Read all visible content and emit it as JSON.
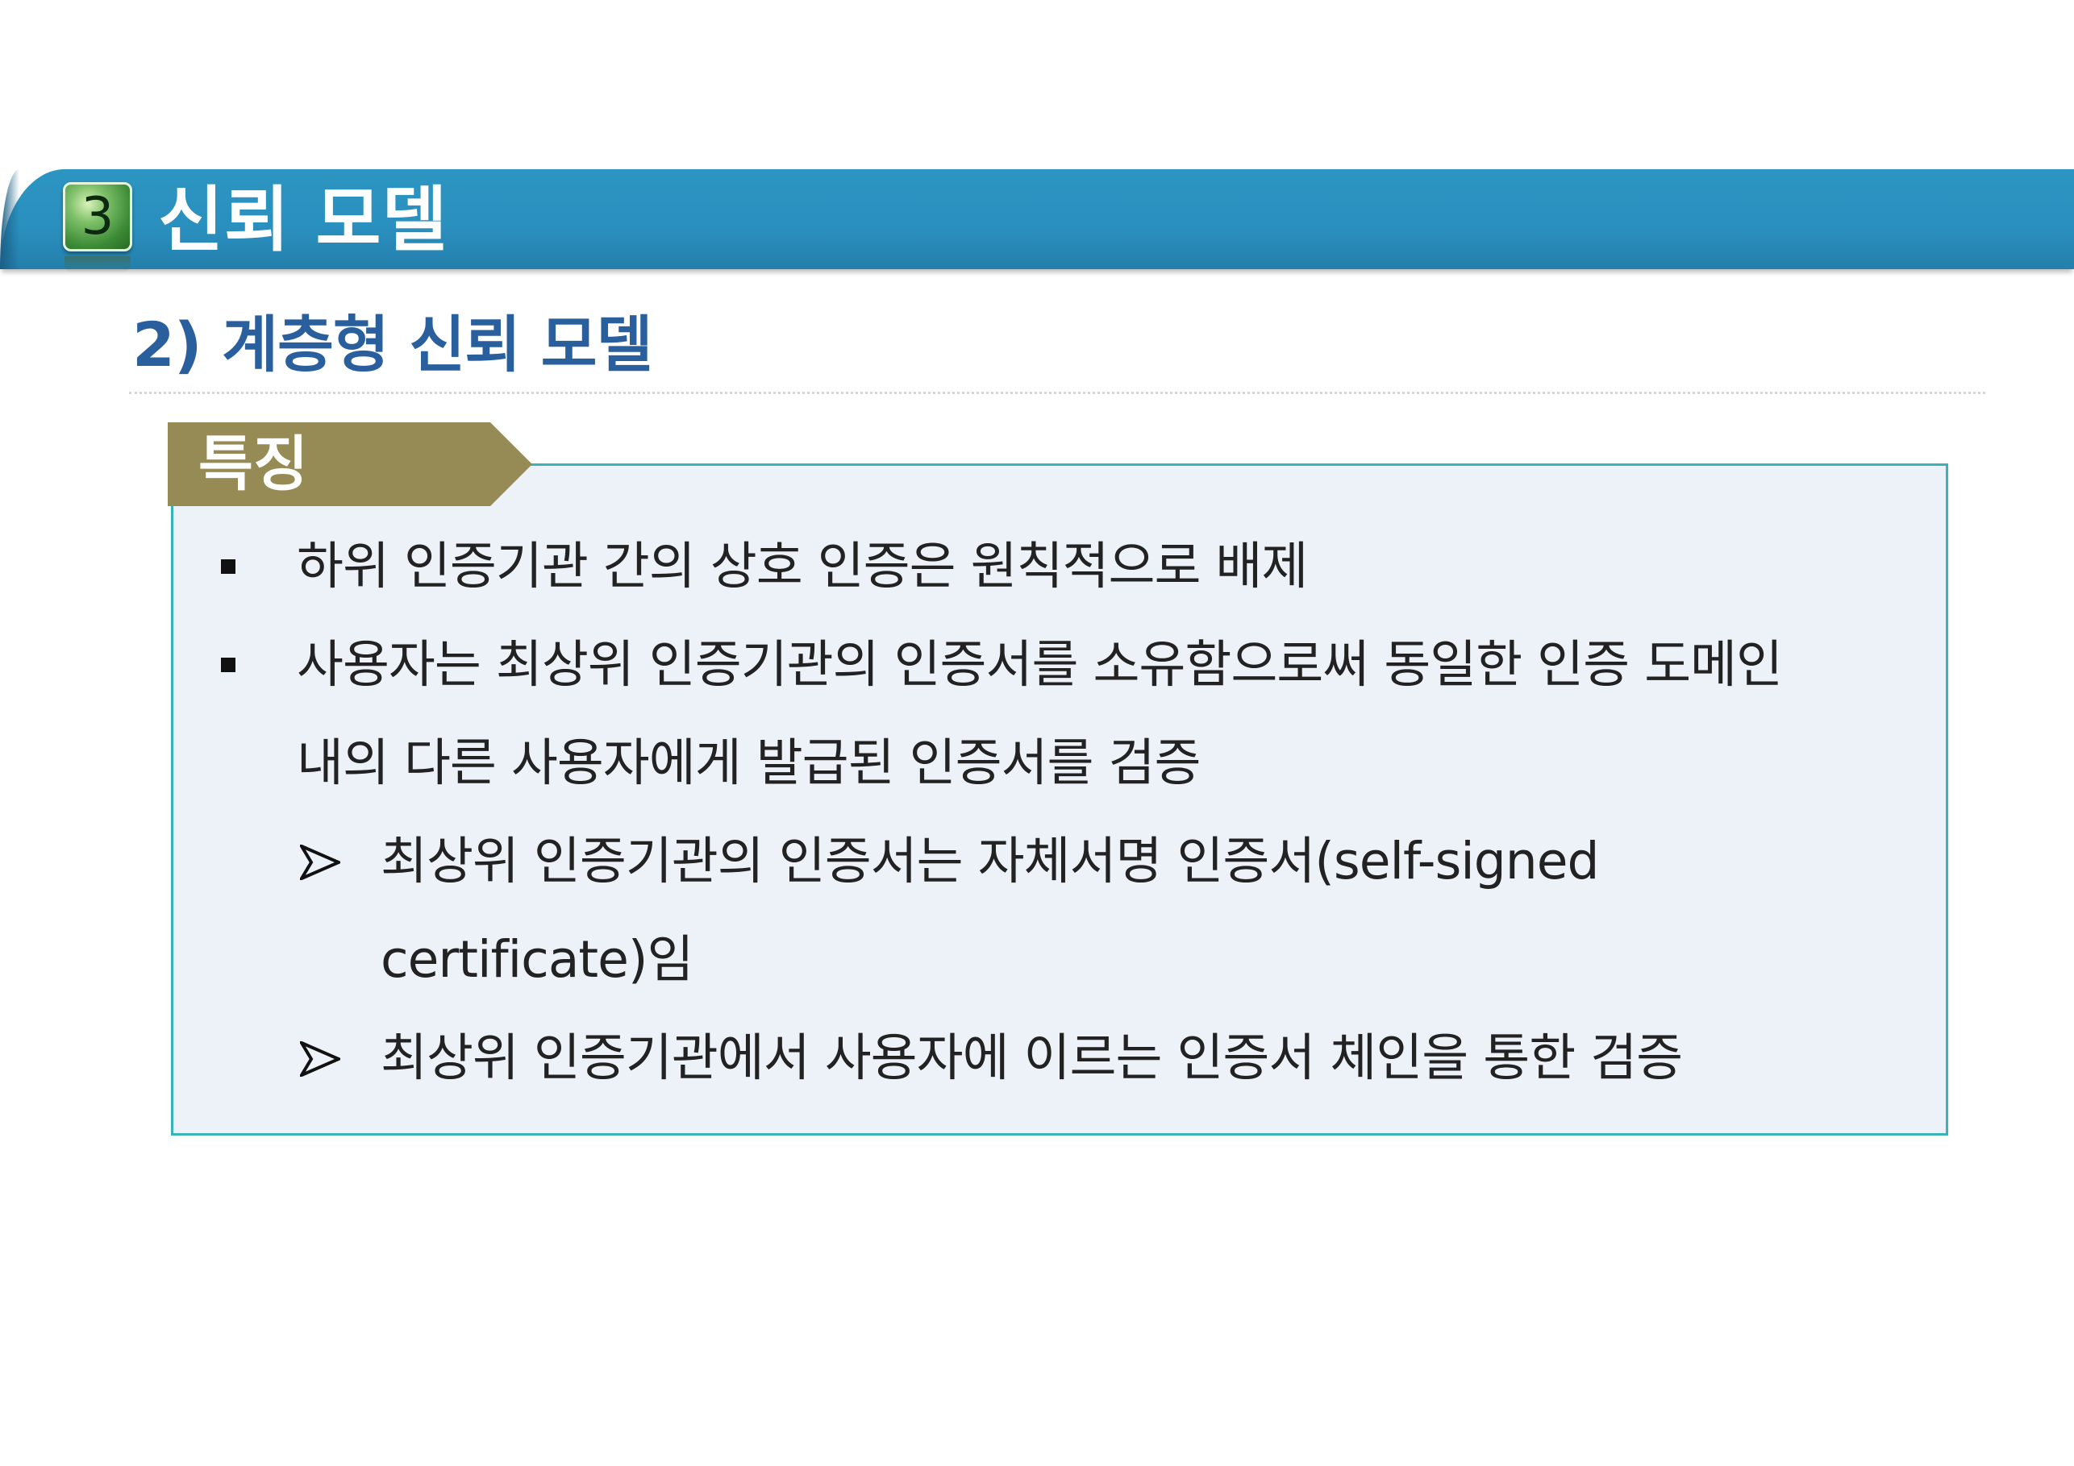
{
  "header": {
    "badge_number": "3",
    "title": "신뢰 모델"
  },
  "subtitle": "2) 계층형 신뢰 모델",
  "section": {
    "tab_label": "특징",
    "tab_color": "#968a55",
    "border_color": "#39b3b7",
    "items": [
      {
        "type": "square-bullet",
        "lines": [
          "하위 인증기관 간의 상호 인증은 원칙적으로 배제"
        ]
      },
      {
        "type": "square-bullet",
        "lines": [
          "사용자는 최상위 인증기관의 인증서를 소유함으로써 동일한 인증 도메인",
          "내의 다른 사용자에게 발급된 인증서를 검증"
        ]
      },
      {
        "type": "arrow-bullet",
        "lines": [
          "최상위 인증기관의 인증서는 자체서명 인증서(self-signed",
          "certificate)임"
        ]
      },
      {
        "type": "arrow-bullet",
        "lines": [
          "최상위 인증기관에서 사용자에 이르는 인증서 체인을 통한 검증"
        ]
      }
    ]
  }
}
